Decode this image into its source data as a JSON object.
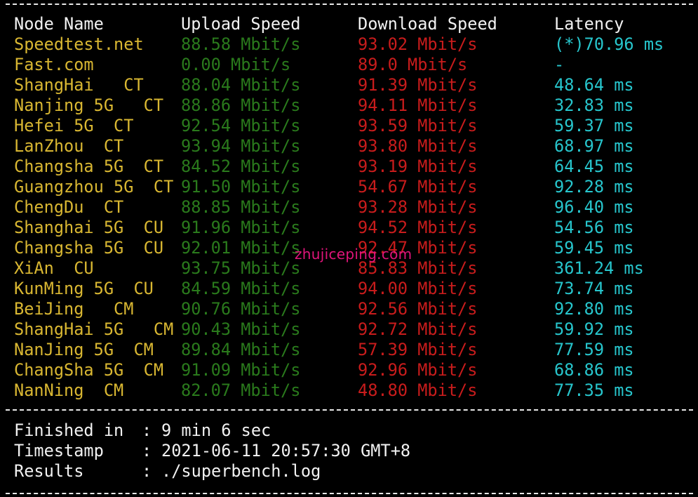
{
  "header": {
    "node": "Node Name",
    "upload": "Upload Speed",
    "download": "Download Speed",
    "latency": "Latency"
  },
  "rows": [
    {
      "node": "Speedtest.net",
      "upload": "88.58 Mbit/s",
      "download": "93.02 Mbit/s",
      "latency": "(*)70.96 ms"
    },
    {
      "node": "Fast.com",
      "upload": "0.00 Mbit/s",
      "download": "89.0 Mbit/s",
      "latency": "-"
    },
    {
      "node": "ShangHai   CT",
      "upload": "88.04 Mbit/s",
      "download": "91.39 Mbit/s",
      "latency": "48.64 ms"
    },
    {
      "node": "Nanjing 5G   CT",
      "upload": "88.86 Mbit/s",
      "download": "94.11 Mbit/s",
      "latency": "32.83 ms"
    },
    {
      "node": "Hefei 5G  CT",
      "upload": "92.54 Mbit/s",
      "download": "93.59 Mbit/s",
      "latency": "59.37 ms"
    },
    {
      "node": "LanZhou  CT",
      "upload": "93.94 Mbit/s",
      "download": "93.80 Mbit/s",
      "latency": "68.97 ms"
    },
    {
      "node": "Changsha 5G  CT",
      "upload": "84.52 Mbit/s",
      "download": "93.19 Mbit/s",
      "latency": "64.45 ms"
    },
    {
      "node": "Guangzhou 5G  CT",
      "upload": "91.50 Mbit/s",
      "download": "54.67 Mbit/s",
      "latency": "92.28 ms"
    },
    {
      "node": "ChengDu  CT",
      "upload": "88.85 Mbit/s",
      "download": "93.28 Mbit/s",
      "latency": "96.40 ms"
    },
    {
      "node": "Shanghai 5G  CU",
      "upload": "91.96 Mbit/s",
      "download": "94.52 Mbit/s",
      "latency": "54.56 ms"
    },
    {
      "node": "Changsha 5G  CU",
      "upload": "92.01 Mbit/s",
      "download": "92.47 Mbit/s",
      "latency": "59.45 ms"
    },
    {
      "node": "XiAn  CU",
      "upload": "93.75 Mbit/s",
      "download": "85.83 Mbit/s",
      "latency": "361.24 ms"
    },
    {
      "node": "KunMing 5G  CU",
      "upload": "84.59 Mbit/s",
      "download": "94.00 Mbit/s",
      "latency": "73.74 ms"
    },
    {
      "node": "BeiJing   CM",
      "upload": "90.76 Mbit/s",
      "download": "92.56 Mbit/s",
      "latency": "92.80 ms"
    },
    {
      "node": "ShangHai 5G   CM",
      "upload": "90.43 Mbit/s",
      "download": "92.72 Mbit/s",
      "latency": "59.92 ms"
    },
    {
      "node": "NanJing 5G  CM",
      "upload": "89.84 Mbit/s",
      "download": "57.39 Mbit/s",
      "latency": "77.59 ms"
    },
    {
      "node": "ChangSha 5G  CM",
      "upload": "91.09 Mbit/s",
      "download": "92.96 Mbit/s",
      "latency": "68.86 ms"
    },
    {
      "node": "NanNing  CM",
      "upload": "82.07 Mbit/s",
      "download": "48.80 Mbit/s",
      "latency": "77.35 ms"
    }
  ],
  "summary": [
    {
      "label": "Finished in",
      "sep": ":",
      "value": "9 min 6 sec"
    },
    {
      "label": "Timestamp",
      "sep": ":",
      "value": "2021-06-11 20:57:30 GMT+8"
    },
    {
      "label": "Results",
      "sep": ":",
      "value": "./superbench.log"
    }
  ],
  "watermark": "zhujiceping.com",
  "colors": {
    "background": "#000000",
    "node": "#d9b732",
    "upload": "#2a7a1c",
    "download": "#c81c1c",
    "latency": "#27c6cd",
    "watermark": "#e0157a"
  }
}
